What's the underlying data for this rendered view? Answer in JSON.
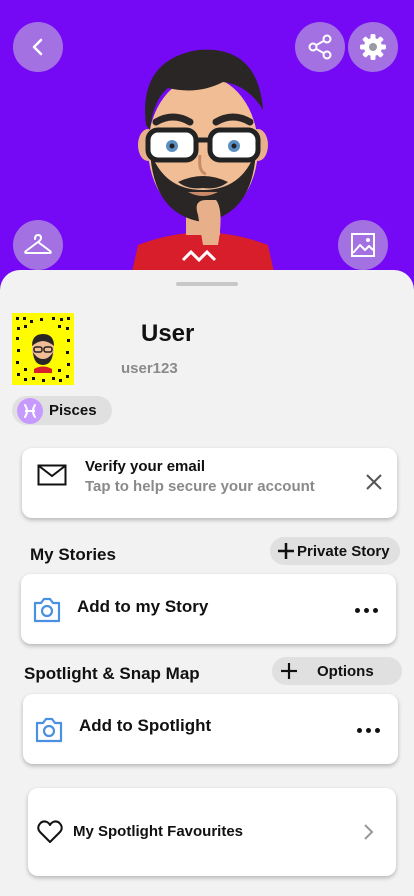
{
  "profile": {
    "display_name": "User",
    "username": "user123",
    "zodiac": "Pisces",
    "zodiac_symbol": "♓"
  },
  "verify_email": {
    "title": "Verify your email",
    "subtitle": "Tap to help secure your account"
  },
  "my_stories": {
    "title": "My Stories",
    "private_story_label": "Private Story",
    "add_label": "Add to my Story"
  },
  "spotlight": {
    "title": "Spotlight & Snap Map",
    "options_label": "Options",
    "add_label": "Add to Spotlight",
    "favourites_label": "My Spotlight Favourites"
  },
  "colors": {
    "header_bg": "#7508f5",
    "snapcode_yellow": "#fffc00",
    "camera_icon_blue": "#4a90e2"
  }
}
